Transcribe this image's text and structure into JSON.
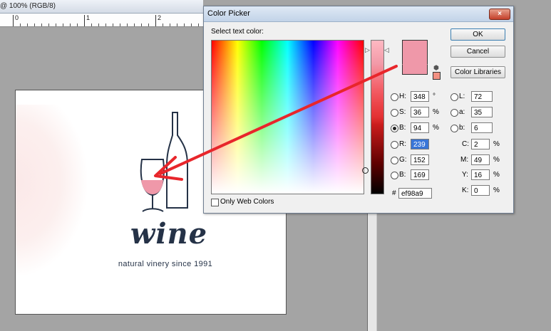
{
  "document": {
    "title": "@ 100% (RGB/8)",
    "ruler_numbers": [
      "0",
      "1",
      "2"
    ],
    "logo_word": "wine",
    "logo_tagline": "natural vinery since 1991"
  },
  "dialog": {
    "title": "Color Picker",
    "close_glyph": "×",
    "prompt": "Select text color:",
    "buttons": {
      "ok": "OK",
      "cancel": "Cancel",
      "libraries": "Color Libraries"
    },
    "fields": {
      "H": {
        "label": "H:",
        "value": "348",
        "unit": "°"
      },
      "S": {
        "label": "S:",
        "value": "36",
        "unit": "%"
      },
      "Bv": {
        "label": "B:",
        "value": "94",
        "unit": "%"
      },
      "R": {
        "label": "R:",
        "value": "239",
        "unit": ""
      },
      "G": {
        "label": "G:",
        "value": "152",
        "unit": ""
      },
      "Bb": {
        "label": "B:",
        "value": "169",
        "unit": ""
      },
      "L": {
        "label": "L:",
        "value": "72",
        "unit": ""
      },
      "a": {
        "label": "a:",
        "value": "35",
        "unit": ""
      },
      "b": {
        "label": "b:",
        "value": "6",
        "unit": ""
      },
      "C": {
        "label": "C:",
        "value": "2",
        "unit": "%"
      },
      "M": {
        "label": "M:",
        "value": "49",
        "unit": "%"
      },
      "Y": {
        "label": "Y:",
        "value": "16",
        "unit": "%"
      },
      "K": {
        "label": "K:",
        "value": "0",
        "unit": "%"
      },
      "hex": {
        "label": "#",
        "value": "ef98a9"
      }
    },
    "selected_mode": "B",
    "only_web_colors_label": "Only Web Colors",
    "only_web_colors_checked": false
  },
  "colors": {
    "picked": "#ef98a9",
    "arrow": "#e8262b",
    "logo_ink": "#253247"
  },
  "icons": [
    "close-icon",
    "gamut-warning-icon",
    "websafe-cube-icon",
    "slider-arrow-icon",
    "wine-bottle-icon",
    "wine-glass-icon"
  ]
}
